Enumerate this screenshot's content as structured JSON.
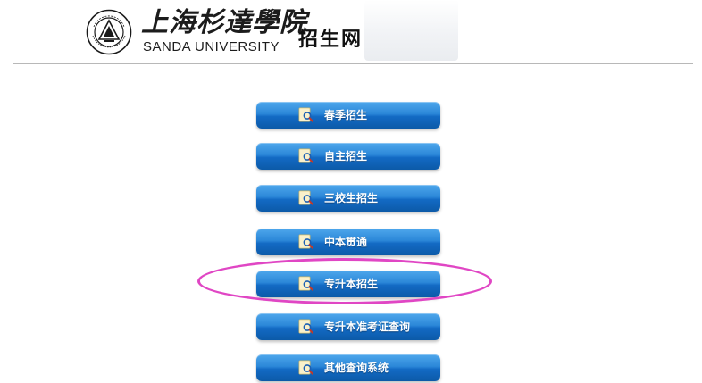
{
  "header": {
    "logo_cn": "上海杉達學院",
    "logo_en": "SANDA UNIVERSITY",
    "site_title": "招生网",
    "seal_text": "SANDA UNIVERSITY",
    "seal_year": "1992"
  },
  "menu": {
    "items": [
      {
        "label": "春季招生",
        "icon": "document-search-icon"
      },
      {
        "label": "自主招生",
        "icon": "document-search-icon"
      },
      {
        "label": "三校生招生",
        "icon": "document-search-icon"
      },
      {
        "label": "中本贯通",
        "icon": "document-search-icon"
      },
      {
        "label": "专升本招生",
        "icon": "document-search-icon"
      },
      {
        "label": "专升本准考证查询",
        "icon": "document-search-icon"
      },
      {
        "label": "其他查询系统",
        "icon": "document-search-icon"
      }
    ]
  },
  "highlight": {
    "target": "专升本招生",
    "color": "#e046c4"
  },
  "colors": {
    "button_top": "#4ea7ec",
    "button_bottom": "#0c5aa8",
    "divider": "#b8b8b8"
  }
}
